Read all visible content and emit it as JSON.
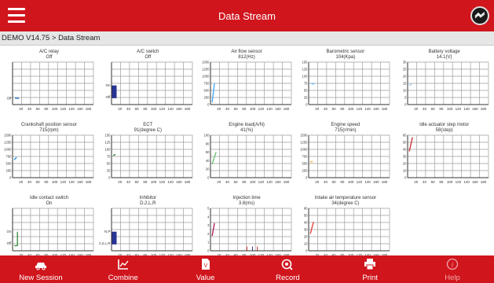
{
  "header": {
    "title": "Data Stream",
    "menu_icon": "hamburger-menu-icon",
    "vci_icon": "vci-connection-icon"
  },
  "breadcrumb": "DEMO V14.75 > Data Stream",
  "x_ticks": [
    "20",
    "40",
    "60",
    "80",
    "100",
    "120",
    "140",
    "160",
    "180"
  ],
  "graphs": [
    {
      "name": "A/C relay",
      "value": "Off",
      "y_ticks": [],
      "state_labels": [
        "Off"
      ],
      "color": "#1565c0"
    },
    {
      "name": "A/C switch",
      "value": "Off",
      "y_ticks": [],
      "state_labels": [
        "On",
        "Off"
      ],
      "color": "#283593"
    },
    {
      "name": "Air flow sensor",
      "value": "812(Hz)",
      "y_ticks": [
        "1500",
        "1250",
        "1000",
        "750",
        "500",
        "250",
        "0"
      ],
      "state_labels": [],
      "color": "#42a5f5"
    },
    {
      "name": "Barometric sensor",
      "value": "104(Kpa)",
      "y_ticks": [
        "150",
        "125",
        "100",
        "75",
        "50",
        "25",
        "0"
      ],
      "state_labels": [],
      "color": "#64b5f6"
    },
    {
      "name": "Battery voltage",
      "value": "14.1(V)",
      "y_ticks": [
        "30",
        "25",
        "20",
        "15",
        "10",
        "5",
        "0"
      ],
      "state_labels": [],
      "color": "#90caf9"
    },
    {
      "name": "Crankshaft position sensor",
      "value": "715(rpm)",
      "y_ticks": [
        "1500",
        "1250",
        "1000",
        "750",
        "500",
        "250",
        "0"
      ],
      "state_labels": [],
      "color": "#1e88e5"
    },
    {
      "name": "ECT",
      "value": "91(degree C)",
      "y_ticks": [
        "150",
        "125",
        "100",
        "75",
        "50",
        "25",
        "0"
      ],
      "state_labels": [],
      "color": "#2e7d32"
    },
    {
      "name": "Engine load(A/N)",
      "value": "41(%)",
      "y_ticks": [
        "100",
        "80",
        "60",
        "40",
        "20",
        "0"
      ],
      "state_labels": [],
      "color": "#66bb6a"
    },
    {
      "name": "Engine speed",
      "value": "715(r/min)",
      "y_ticks": [
        "1500",
        "1250",
        "1000",
        "750",
        "500",
        "250",
        "0"
      ],
      "state_labels": [],
      "color": "#ffa726"
    },
    {
      "name": "Idle actuator step motor",
      "value": "58(step)",
      "y_ticks": [
        "60",
        "50",
        "40",
        "30",
        "20",
        "10",
        "0"
      ],
      "state_labels": [],
      "color": "#c62828"
    },
    {
      "name": "Idle contact switch",
      "value": "On",
      "y_ticks": [],
      "state_labels": [
        "On",
        "Off"
      ],
      "color": "#388e3c"
    },
    {
      "name": "Inhibitor",
      "value": "D,2,L,R",
      "y_ticks": [],
      "state_labels": [
        "N,P",
        "D,2,L,R"
      ],
      "color": "#283593"
    },
    {
      "name": "Injection time",
      "value": "3.8(ms)",
      "y_ticks": [
        "5",
        "4",
        "3",
        "2",
        "1",
        "0"
      ],
      "state_labels": [],
      "color": "#ad1457"
    },
    {
      "name": "Intake air temperature sensor",
      "value": "34(degree C)",
      "y_ticks": [
        "60",
        "50",
        "40",
        "30",
        "20",
        "10",
        "0"
      ],
      "state_labels": [],
      "color": "#e53935"
    }
  ],
  "toolbar": [
    {
      "label": "New Session",
      "icon": "car-icon",
      "enabled": true
    },
    {
      "label": "Combine",
      "icon": "combine-chart-icon",
      "enabled": true
    },
    {
      "label": "Value",
      "icon": "value-document-icon",
      "enabled": true
    },
    {
      "label": "Record",
      "icon": "record-icon",
      "enabled": true
    },
    {
      "label": "Print",
      "icon": "printer-icon",
      "enabled": true
    },
    {
      "label": "Help",
      "icon": "help-icon",
      "enabled": false
    }
  ]
}
